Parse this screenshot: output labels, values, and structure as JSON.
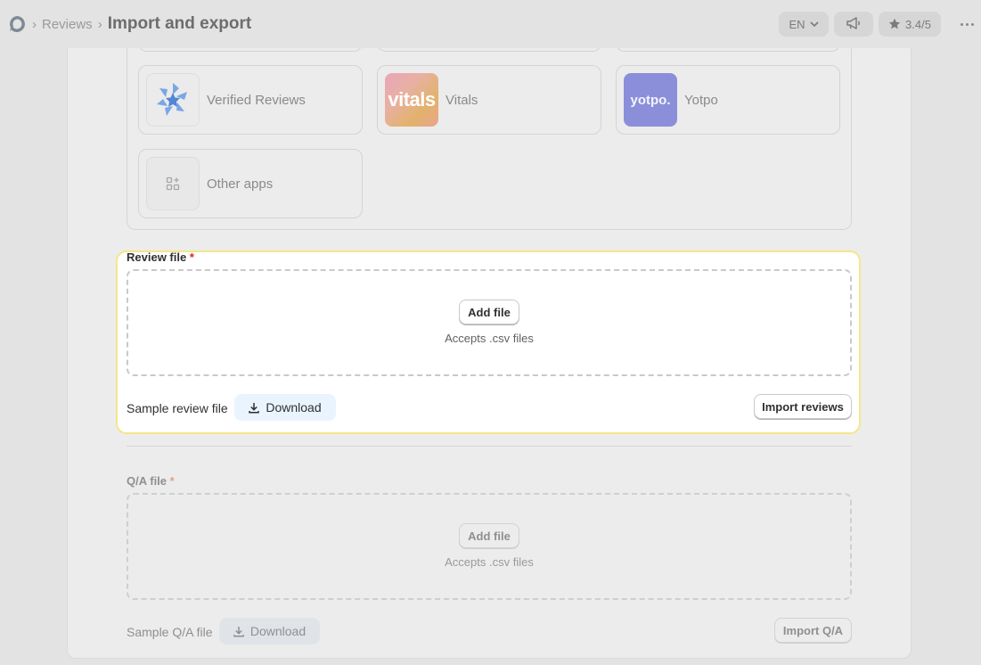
{
  "header": {
    "breadcrumb_parent": "Reviews",
    "page_title": "Import and export",
    "language": "EN",
    "rating": "3.4/5"
  },
  "apps": [
    {
      "name": "Verified Reviews",
      "icon": "verified-reviews-logo"
    },
    {
      "name": "Vitals",
      "icon_text": "vitals"
    },
    {
      "name": "Yotpo",
      "icon_text": "yotpo."
    },
    {
      "name": "Other apps",
      "icon": "apps-plus-icon"
    }
  ],
  "review_file": {
    "label": "Review file",
    "required_mark": "*",
    "add_file_label": "Add file",
    "accepts_hint": "Accepts .csv files",
    "sample_label": "Sample review file",
    "download_label": "Download",
    "import_label": "Import reviews"
  },
  "qa_file": {
    "label": "Q/A file",
    "required_mark": "*",
    "add_file_label": "Add file",
    "accepts_hint": "Accepts .csv files",
    "sample_label": "Sample Q/A file",
    "download_label": "Download",
    "import_label": "Import Q/A"
  },
  "colors": {
    "highlight_border": "#f5e68a",
    "download_bg": "#eaf4ff",
    "required": "#d72c0d"
  }
}
